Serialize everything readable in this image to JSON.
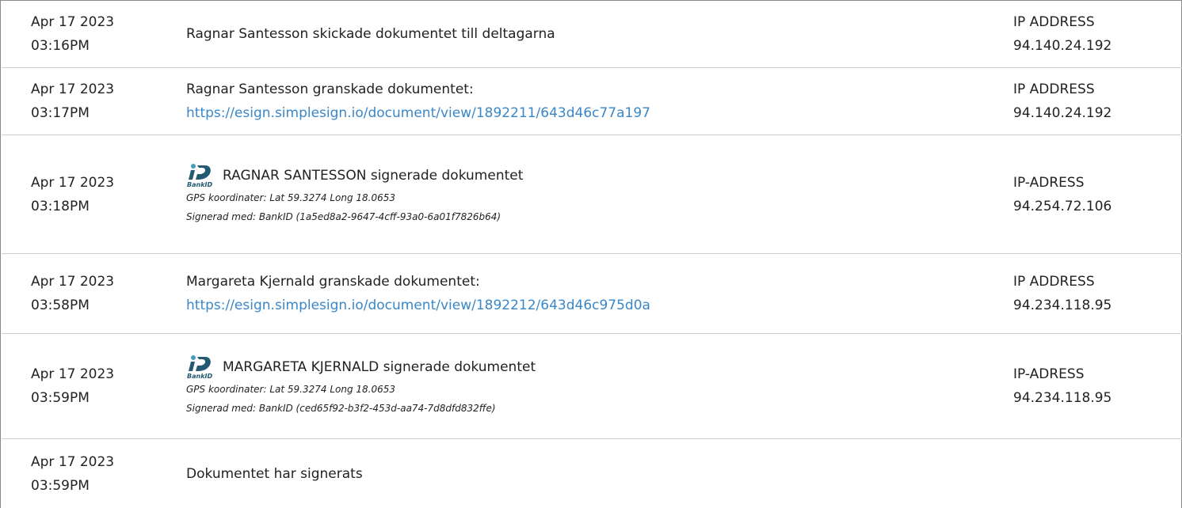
{
  "rows": [
    {
      "date": "Apr 17 2023",
      "time": "03:16PM",
      "event": "Ragnar Santesson skickade dokumentet till deltagarna",
      "ip_label": "IP ADDRESS",
      "ip_value": "94.140.24.192"
    },
    {
      "date": "Apr 17 2023",
      "time": "03:17PM",
      "event": "Ragnar Santesson granskade dokumentet:",
      "link": "https://esign.simplesign.io/document/view/1892211/643d46c77a197",
      "ip_label": "IP ADDRESS",
      "ip_value": "94.140.24.192"
    },
    {
      "date": "Apr 17 2023",
      "time": "03:18PM",
      "event": "RAGNAR SANTESSON signerade dokumentet",
      "gps": "GPS koordinater: Lat 59.3274 Long 18.0653",
      "signed_with": "Signerad med: BankID (1a5ed8a2-9647-4cff-93a0-6a01f7826b64)",
      "ip_label": "IP-ADRESS",
      "ip_value": "94.254.72.106",
      "icon": "bankid-icon"
    },
    {
      "date": "Apr 17 2023",
      "time": "03:58PM",
      "event": "Margareta Kjernald granskade dokumentet:",
      "link": "https://esign.simplesign.io/document/view/1892212/643d46c975d0a",
      "ip_label": "IP ADDRESS",
      "ip_value": "94.234.118.95"
    },
    {
      "date": "Apr 17 2023",
      "time": "03:59PM",
      "event": "MARGARETA KJERNALD signerade dokumentet",
      "gps": "GPS koordinater: Lat 59.3274 Long 18.0653",
      "signed_with": "Signerad med: BankID (ced65f92-b3f2-453d-aa74-7d8dfd832ffe)",
      "ip_label": "IP-ADRESS",
      "ip_value": "94.234.118.95",
      "icon": "bankid-icon"
    },
    {
      "date": "Apr 17 2023",
      "time": "03:59PM",
      "event": "Dokumentet har signerats"
    }
  ],
  "colors": {
    "link": "#3a87c8",
    "bankid_blue": "#235971",
    "bankid_light": "#469cbe",
    "row_divider": "#cfcfcf"
  }
}
